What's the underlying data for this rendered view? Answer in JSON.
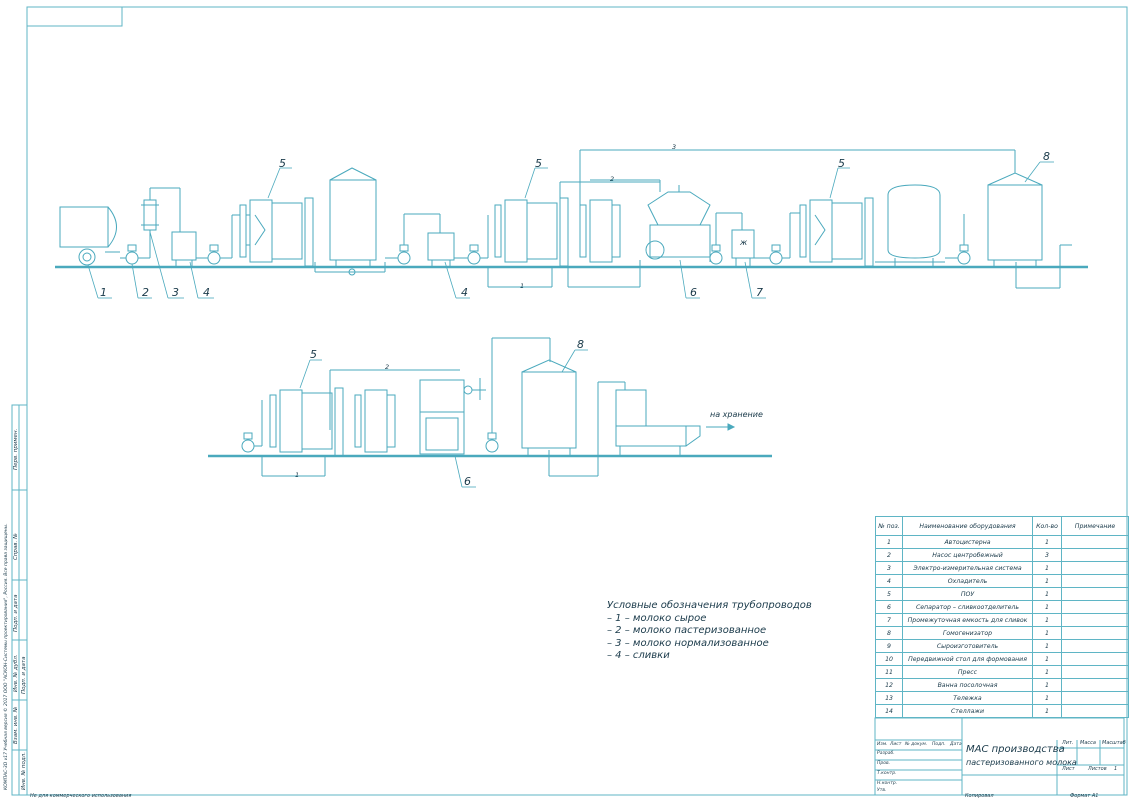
{
  "callouts": {
    "n1": "1",
    "n2": "2",
    "n3": "3",
    "n4": "4",
    "n5": "5",
    "n6": "6",
    "n7": "7",
    "n8": "8",
    "zh": "ж"
  },
  "line_tags": {
    "l1": "1",
    "l2": "2",
    "l3": "3"
  },
  "storage_label": "на хранение",
  "legend": {
    "title": "Условные обозначения трубопроводов",
    "items": [
      "– 1 – молоко сырое",
      "– 2 – молоко пастеризованное",
      "– 3 – молоко нормализованное",
      "– 4 – сливки"
    ]
  },
  "spec_table": {
    "headers": [
      "№ поз.",
      "Наименование оборудования",
      "Кол-во",
      "Примечание"
    ],
    "rows": [
      [
        "1",
        "Автоцистерна",
        "1"
      ],
      [
        "2",
        "Насос центробежный",
        "3"
      ],
      [
        "3",
        "Электро-измерительная система",
        "1"
      ],
      [
        "4",
        "Охладитель",
        "1"
      ],
      [
        "5",
        "ПОУ",
        "1"
      ],
      [
        "6",
        "Сепаратор – сливкоотделитель",
        "1"
      ],
      [
        "7",
        "Промежуточная емкость для сливок",
        "1"
      ],
      [
        "8",
        "Гомогенизатор",
        "1"
      ],
      [
        "9",
        "Сыроизготовитель",
        "1"
      ],
      [
        "10",
        "Передвижной стол для формования",
        "1"
      ],
      [
        "11",
        "Пресс",
        "1"
      ],
      [
        "12",
        "Ванна посолочная",
        "1"
      ],
      [
        "13",
        "Тележка",
        "1"
      ],
      [
        "14",
        "Стеллажи",
        "1"
      ]
    ]
  },
  "title_block": {
    "title_line1": "МАС производства",
    "title_line2": "пастеризованного молока",
    "lit": "Лит.",
    "mass": "Масса",
    "scale": "Масштаб",
    "sheet": "Лист",
    "sheets": "Листов",
    "sheets_num": "1",
    "rows": [
      "Изм.",
      "Лист",
      "№ докум.",
      "Подп.",
      "Дата",
      "Разраб.",
      "Пров.",
      "Т.контр.",
      "Н.контр.",
      "Утв."
    ]
  },
  "footer": {
    "noncommercial": "Не для коммерческого использования",
    "copied": "Копировал",
    "format": "Формат  А1"
  },
  "margin_texts": {
    "m1": "Перв. примен.",
    "m2": "Справ. №",
    "m3": "Подп. и дата",
    "m4": "Инв. № дубл.",
    "m5": "Взам. инв. №",
    "m6": "Подп. и дата",
    "m7": "Инв. № подл.",
    "m8": "КОМПАС-3D v17 Учебная версия © 2017 ООО \"АСКОН-Системы проектирования\", Россия. Все права защищены."
  }
}
